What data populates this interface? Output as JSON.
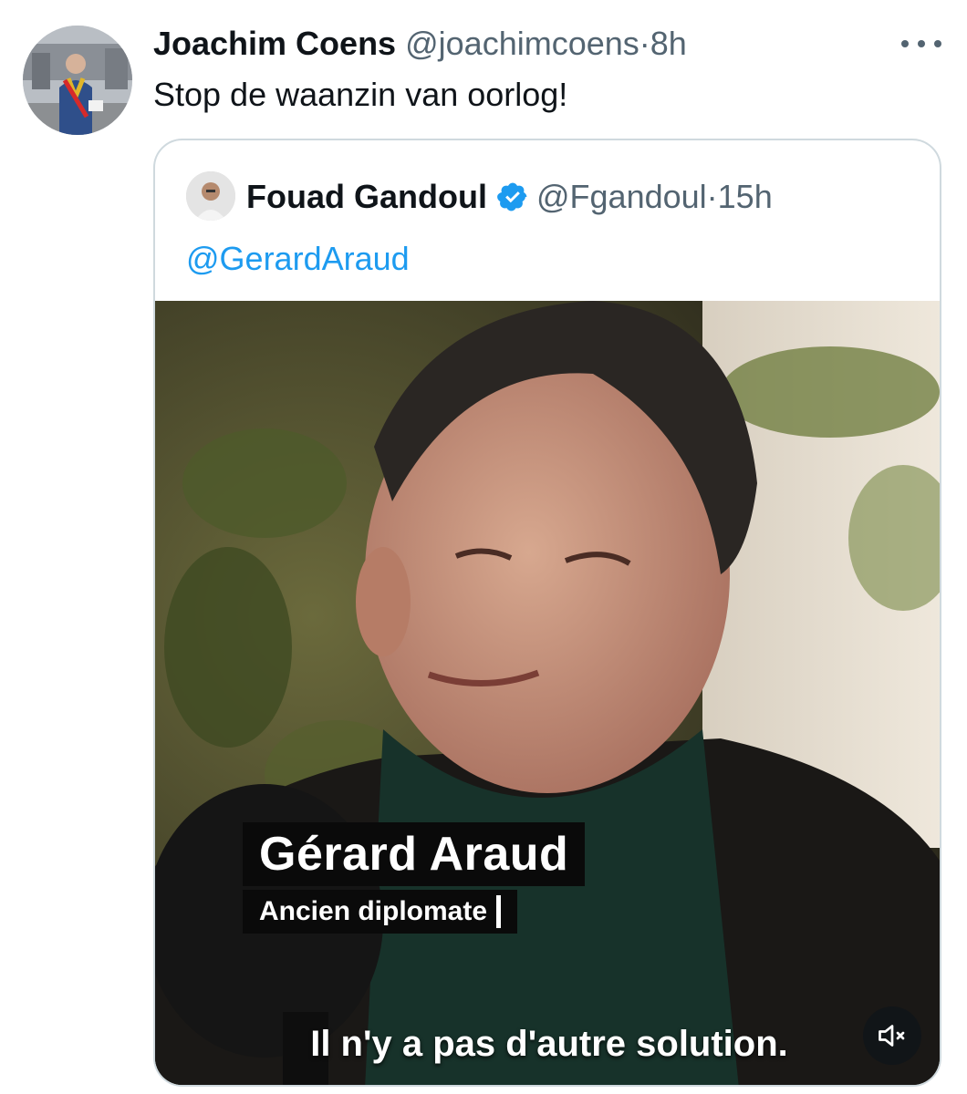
{
  "tweet": {
    "author_name": "Joachim Coens",
    "author_handle": "@joachimcoens",
    "separator": "·",
    "time": "8h",
    "text": "Stop de waanzin van oorlog!"
  },
  "quoted_tweet": {
    "author_name": "Fouad Gandoul",
    "author_handle": "@Fgandoul",
    "separator": "·",
    "time": "15h",
    "mention": "@GerardAraud",
    "verified": true,
    "video": {
      "caption_name": "Gérard Araud",
      "caption_role": "Ancien diplomate",
      "subtitle": "Il n'y a pas d'autre solution.",
      "muted": true
    }
  },
  "icons": {
    "more": "more-horizontal-icon",
    "verified": "verified-badge-icon",
    "mute": "speaker-muted-icon"
  },
  "colors": {
    "link": "#1d9bf0",
    "secondary_text": "#536471",
    "border": "#cfd9de",
    "verified": "#1d9bf0"
  }
}
